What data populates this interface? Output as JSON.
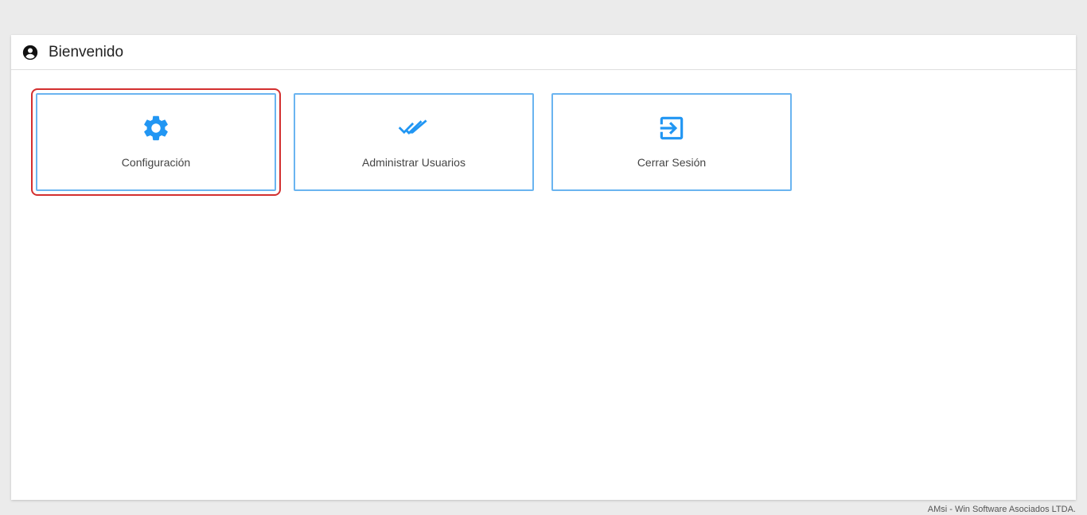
{
  "header": {
    "title": "Bienvenido",
    "icon": "account-circle-icon"
  },
  "tiles": [
    {
      "label": "Configuración",
      "icon": "gear-icon",
      "selected": true
    },
    {
      "label": "Administrar Usuarios",
      "icon": "double-check-icon",
      "selected": false
    },
    {
      "label": "Cerrar Sesión",
      "icon": "exit-icon",
      "selected": false
    }
  ],
  "footer": {
    "text": "AMsi - Win Software Asociados LTDA."
  },
  "colors": {
    "accent": "#2196f3",
    "tile_border": "#6ab4f0",
    "selection": "#d32f2f",
    "background": "#ebebeb"
  }
}
